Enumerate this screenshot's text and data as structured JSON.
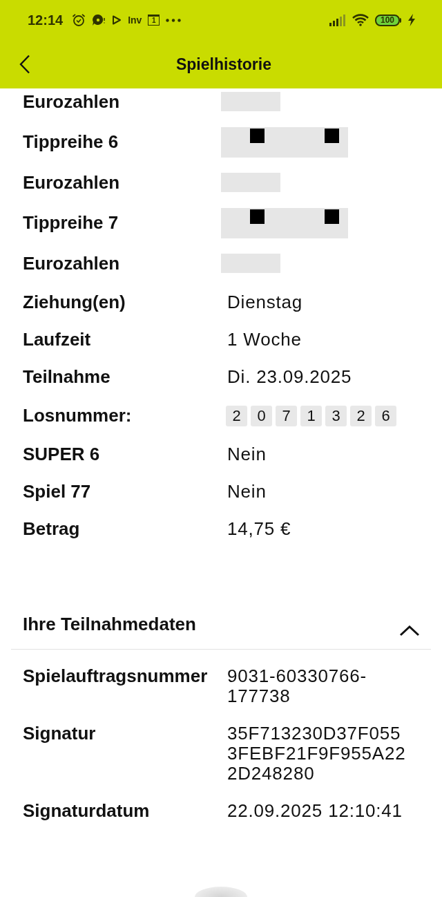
{
  "status_bar": {
    "time": "12:14",
    "notifications": [
      {
        "kind": "alarm"
      },
      {
        "kind": "chat"
      },
      {
        "kind": "play"
      },
      {
        "kind": "label",
        "text": "Inv"
      },
      {
        "kind": "calendar",
        "text": "1"
      },
      {
        "kind": "more"
      }
    ],
    "battery": "100"
  },
  "header": {
    "title": "Spielhistorie"
  },
  "details": [
    {
      "label": "Eurozahlen",
      "kind": "mask"
    },
    {
      "label": "Tippreihe 6",
      "kind": "longmask"
    },
    {
      "label": "Eurozahlen",
      "kind": "mask"
    },
    {
      "label": "Tippreihe 7",
      "kind": "longmask"
    },
    {
      "label": "Eurozahlen",
      "kind": "mask"
    },
    {
      "label": "Ziehung(en)",
      "kind": "text",
      "value": "Dienstag"
    },
    {
      "label": "Laufzeit",
      "kind": "text",
      "value": "1 Woche"
    },
    {
      "label": "Teilnahme",
      "kind": "text",
      "value": "Di. 23.09.2025"
    },
    {
      "label": "Losnummer:",
      "kind": "digits",
      "digits": [
        "2",
        "0",
        "7",
        "1",
        "3",
        "2",
        "6"
      ]
    },
    {
      "label": "SUPER 6",
      "kind": "text",
      "value": "Nein"
    },
    {
      "label": "Spiel 77",
      "kind": "text",
      "value": "Nein"
    },
    {
      "label": "Betrag",
      "kind": "text",
      "value": "14,75 €"
    }
  ],
  "section": {
    "title": "Ihre Teilnahmedaten",
    "expanded": true,
    "rows": [
      {
        "label": "Spielauftragsnummer",
        "lines": [
          "9031-60330766-",
          "177738"
        ]
      },
      {
        "label": "Signatur",
        "lines": [
          "35F713230D37F055",
          "3FEBF21F9F955A22",
          "2D248280"
        ]
      },
      {
        "label": "Signaturdatum",
        "lines": [
          "22.09.2025 12:10:41"
        ]
      }
    ]
  }
}
